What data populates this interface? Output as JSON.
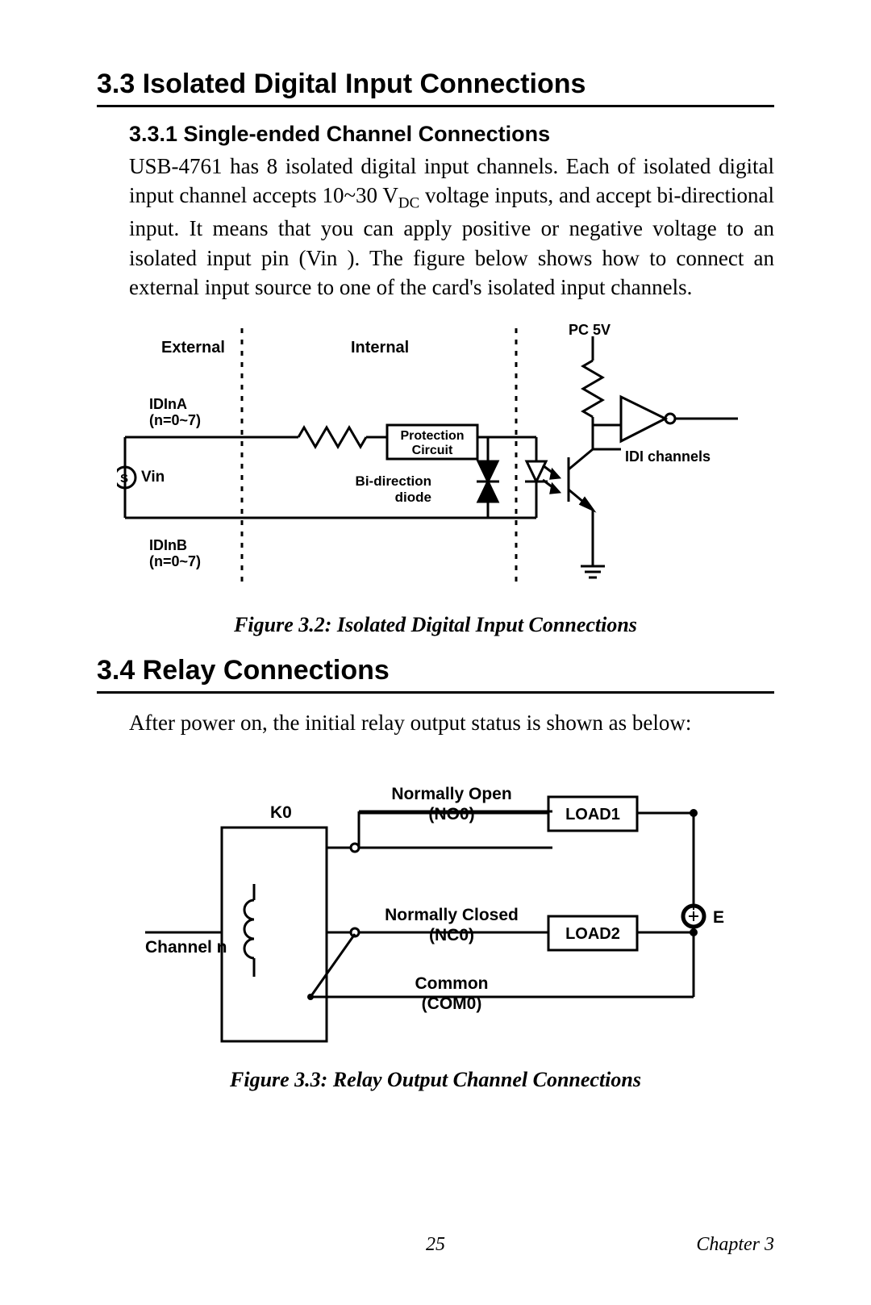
{
  "section33": {
    "heading": "3.3  Isolated Digital Input Connections",
    "sub_heading": "3.3.1 Single-ended Channel Connections",
    "paragraph_html": "USB-4761 has 8 isolated digital input channels. Each of isolated digital input channel accepts 10~30 V<span class=\"sub\">DC</span> voltage inputs, and accept bi-directional input. It means that you can apply positive or negative voltage to an isolated input pin (Vin ). The figure below shows how to connect an external input source to one of the card's isolated input channels."
  },
  "figure32": {
    "caption": "Figure 3.2: Isolated Digital Input Connections",
    "labels": {
      "external": "External",
      "internal": "Internal",
      "pc5v": "PC 5V",
      "idina": "IDInA",
      "idina_range": "(n=0~7)",
      "vin": "Vin",
      "idinb": "IDInB",
      "idinb_range": "(n=0~7)",
      "protection1": "Protection",
      "protection2": "Circuit",
      "bidir1": "Bi-direction",
      "bidir2": "diode",
      "idi_channels": "IDI channels",
      "source_marker": "S"
    }
  },
  "section34": {
    "heading": "3.4  Relay Connections",
    "paragraph": "After power on, the initial relay output status is shown as below:"
  },
  "figure33": {
    "caption": "Figure 3.3: Relay Output Channel Connections",
    "labels": {
      "no_label1": "Normally Open",
      "no_label2": "(NO0)",
      "load1": "LOAD1",
      "k0": "K0",
      "channel_n": "Channel n",
      "nc_label1": "Normally Closed",
      "nc_label2": "(NC0)",
      "load2": "LOAD2",
      "e_marker": "E",
      "e_symbol": "+",
      "common1": "Common",
      "common2": "(COM0)"
    }
  },
  "footer": {
    "page_number": "25",
    "chapter": "Chapter 3"
  }
}
